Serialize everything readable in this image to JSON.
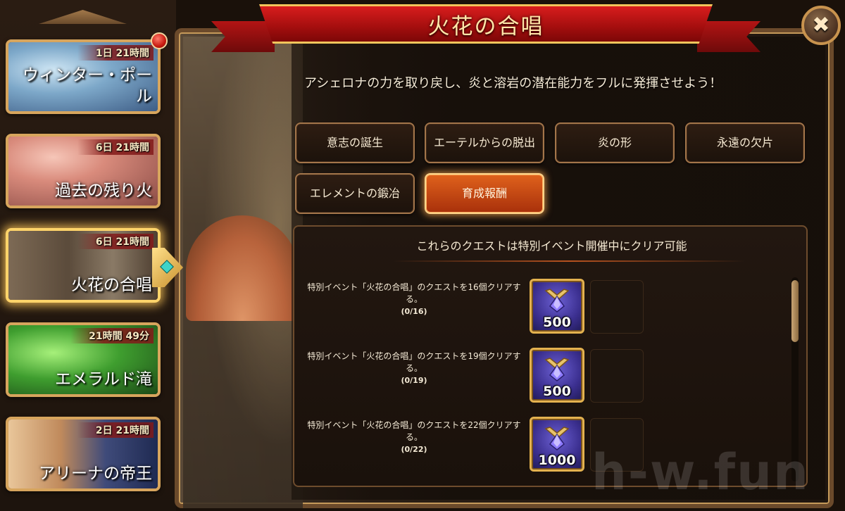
{
  "title": "火花の合唱",
  "close_label": "✖",
  "description": "アシェロナの力を取り戻し、炎と溶岩の潜在能力をフルに発揮させよう！",
  "sidebar": {
    "events": [
      {
        "name": "ウィンター・ポール",
        "timer": "1日 21時間"
      },
      {
        "name": "過去の残り火",
        "timer": "6日 21時間"
      },
      {
        "name": "火花の合唱",
        "timer": "6日 21時間"
      },
      {
        "name": "エメラルド滝",
        "timer": "21時間 49分"
      },
      {
        "name": "アリーナの帝王",
        "timer": "2日 21時間"
      }
    ]
  },
  "tabs": [
    {
      "label": "意志の誕生"
    },
    {
      "label": "エーテルからの脱出"
    },
    {
      "label": "炎の形"
    },
    {
      "label": "永遠の欠片"
    },
    {
      "label": "エレメントの鍛冶"
    },
    {
      "label": "育成報酬"
    }
  ],
  "quests": {
    "header": "これらのクエストは特別イベント開催中にクリア可能",
    "items": [
      {
        "text": "特別イベント「火花の合唱」のクエストを16個クリアする。",
        "progress": "(0/16)",
        "reward": "500"
      },
      {
        "text": "特別イベント「火花の合唱」のクエストを19個クリアする。",
        "progress": "(0/19)",
        "reward": "500"
      },
      {
        "text": "特別イベント「火花の合唱」のクエストを22個クリアする。",
        "progress": "(0/22)",
        "reward": "1000"
      }
    ]
  },
  "watermark": "h-w.fun",
  "colors": {
    "banner": "#c01515",
    "selected_tab": "#d2541a",
    "frame_gold": "#d7a55d"
  }
}
